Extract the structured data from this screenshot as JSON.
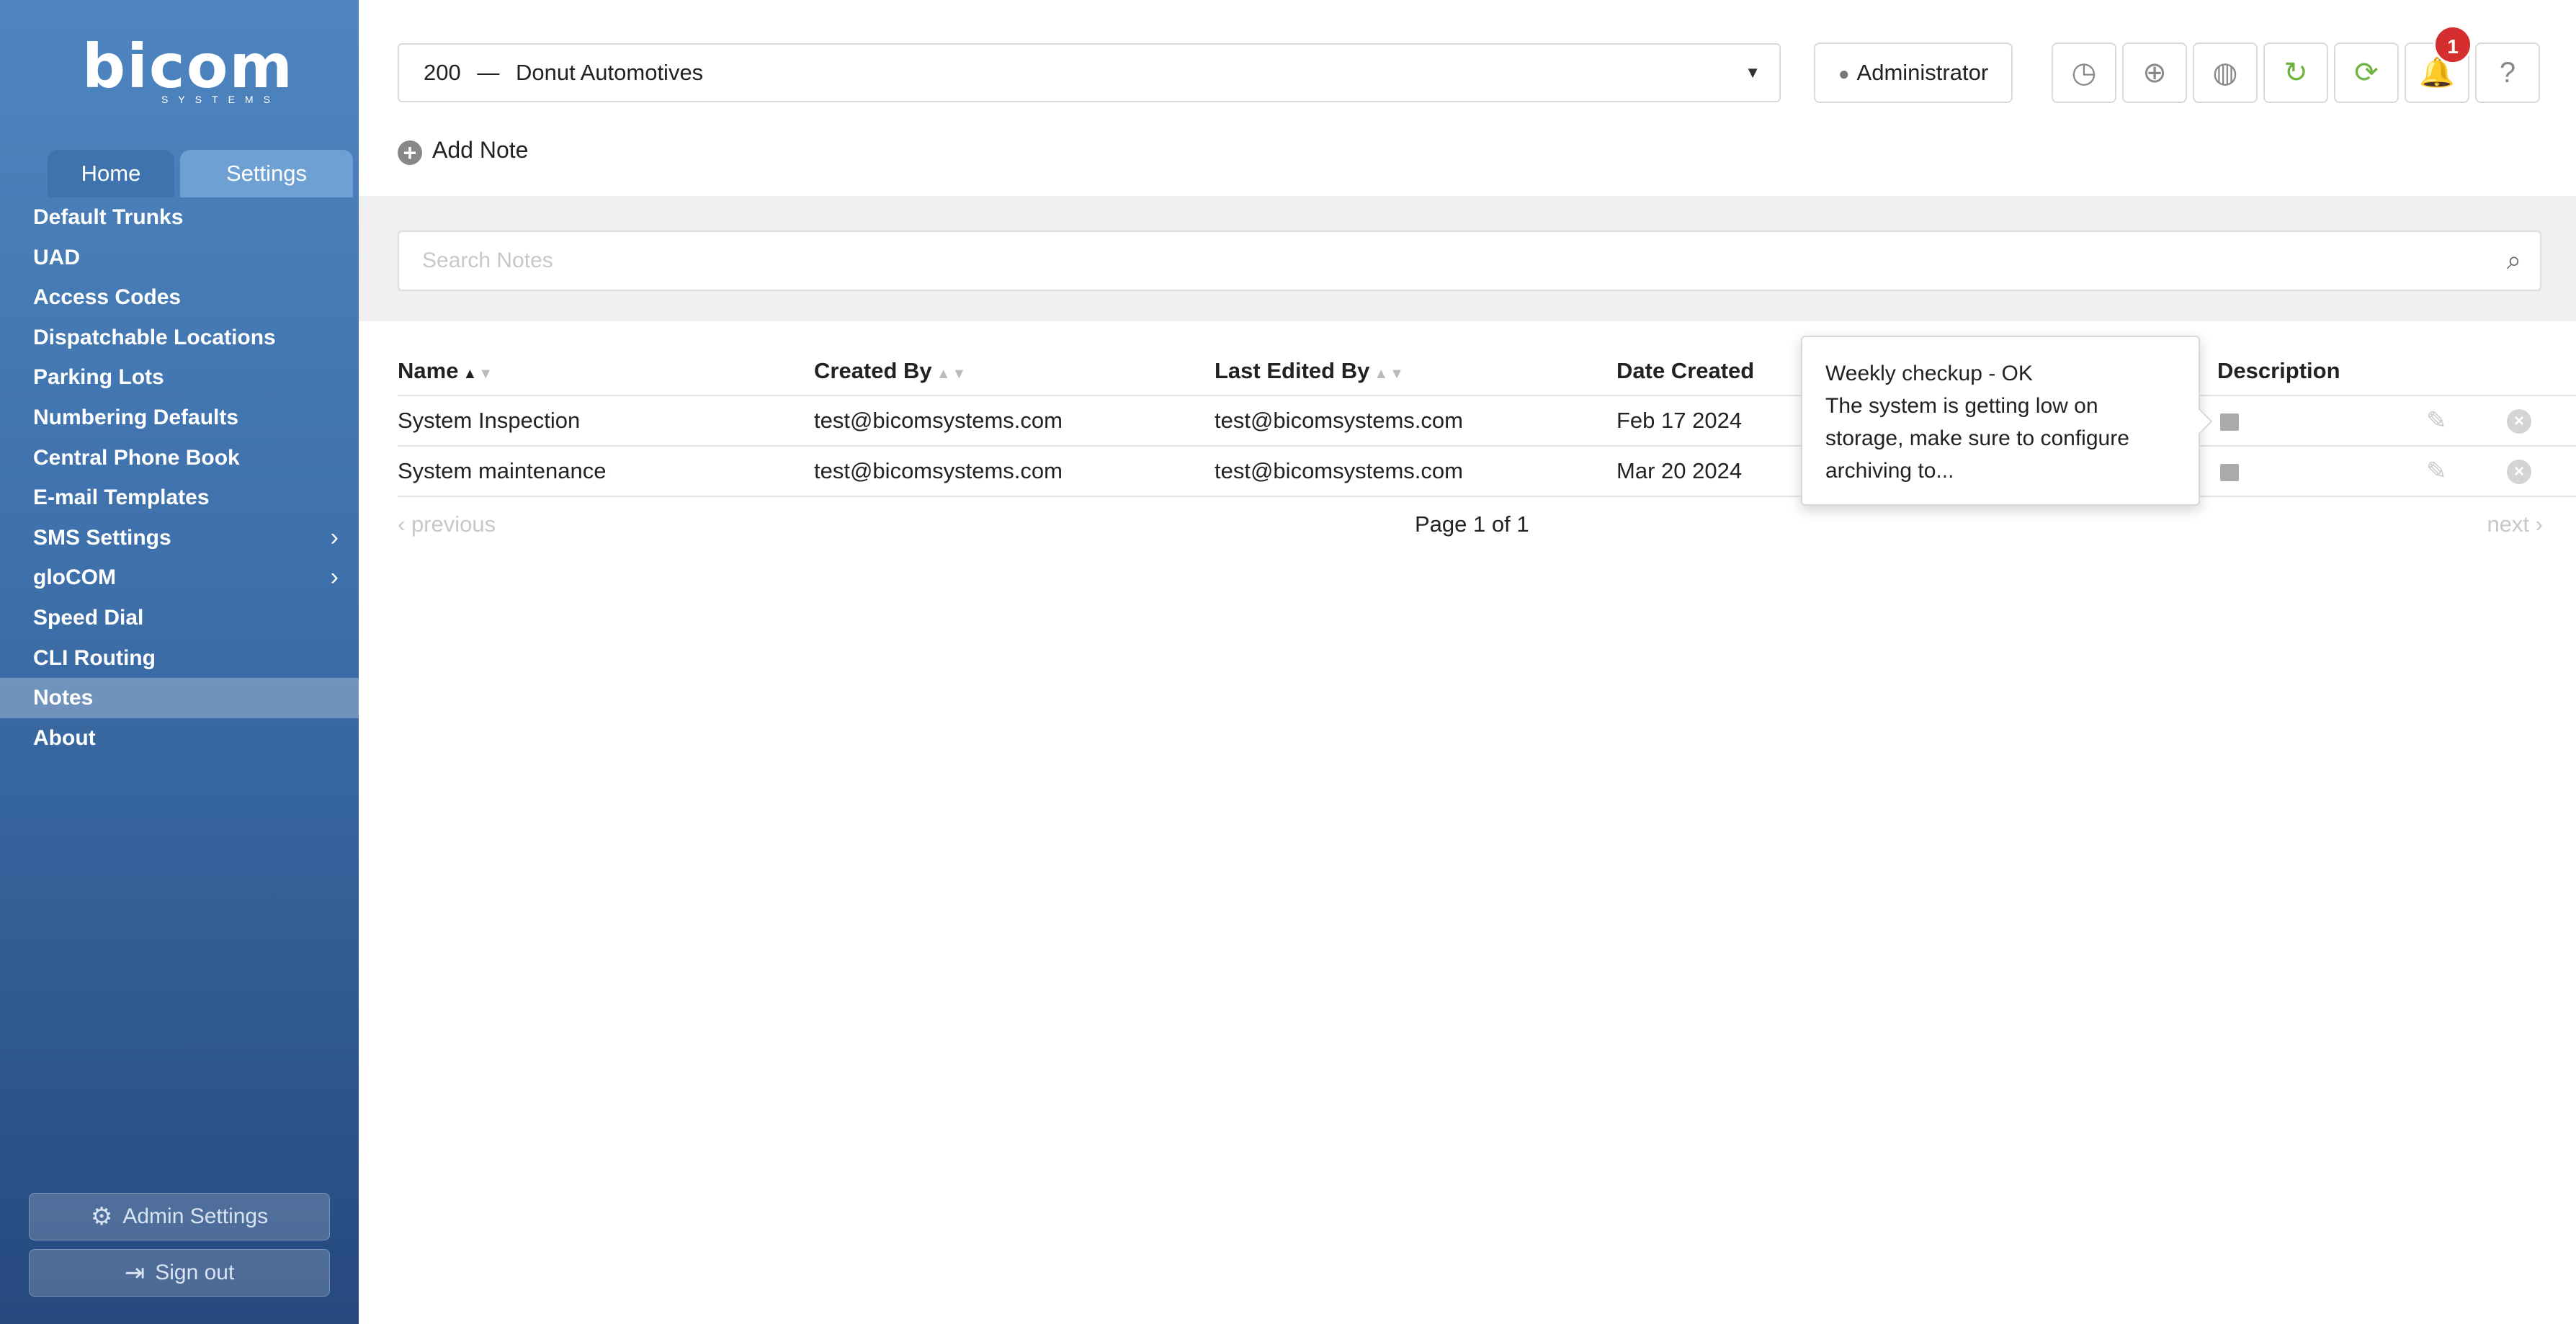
{
  "brand": {
    "name": "bicom",
    "sub": "SYSTEMS"
  },
  "sidebar": {
    "tabs": [
      {
        "label": "Home"
      },
      {
        "label": "Settings"
      }
    ],
    "items": [
      {
        "label": "Default Trunks"
      },
      {
        "label": "UAD"
      },
      {
        "label": "Access Codes"
      },
      {
        "label": "Dispatchable Locations"
      },
      {
        "label": "Parking Lots"
      },
      {
        "label": "Numbering Defaults"
      },
      {
        "label": "Central Phone Book"
      },
      {
        "label": "E-mail Templates"
      },
      {
        "label": "SMS Settings",
        "submenu": true
      },
      {
        "label": "gloCOM",
        "submenu": true
      },
      {
        "label": "Speed Dial"
      },
      {
        "label": "CLI Routing"
      },
      {
        "label": "Notes",
        "active": true
      },
      {
        "label": "About"
      }
    ],
    "admin_settings": "Admin Settings",
    "sign_out": "Sign out"
  },
  "header": {
    "tenant_number": "200",
    "tenant_sep": "—",
    "tenant_name": "Donut Automotives",
    "user": "Administrator",
    "notification_count": "1",
    "icons": [
      "clock-icon",
      "lifebuoy-icon",
      "globe-icon",
      "refresh-icon",
      "sync-icon",
      "bell-icon",
      "help-icon"
    ]
  },
  "actions": {
    "add_note": "Add Note"
  },
  "search": {
    "placeholder": "Search Notes"
  },
  "table": {
    "columns": [
      "Name",
      "Created By",
      "Last Edited By",
      "Date Created",
      "Description"
    ],
    "rows": [
      {
        "name": "System Inspection",
        "created_by": "test@bicomsystems.com",
        "edited_by": "test@bicomsystems.com",
        "date": "Feb 17 2024"
      },
      {
        "name": "System maintenance",
        "created_by": "test@bicomsystems.com",
        "edited_by": "test@bicomsystems.com",
        "date": "Mar 20 2024"
      }
    ]
  },
  "pagination": {
    "prev": "previous",
    "page": "Page 1 of 1",
    "next": "next"
  },
  "tooltip": {
    "text": "Weekly checkup - OK\nThe system is getting low on storage, make sure to configure archiving to..."
  },
  "colors": {
    "accent_green": "#6cb33f",
    "badge_red": "#d42e2e",
    "sidebar_top": "#4e85c0",
    "sidebar_bottom": "#26497e"
  }
}
